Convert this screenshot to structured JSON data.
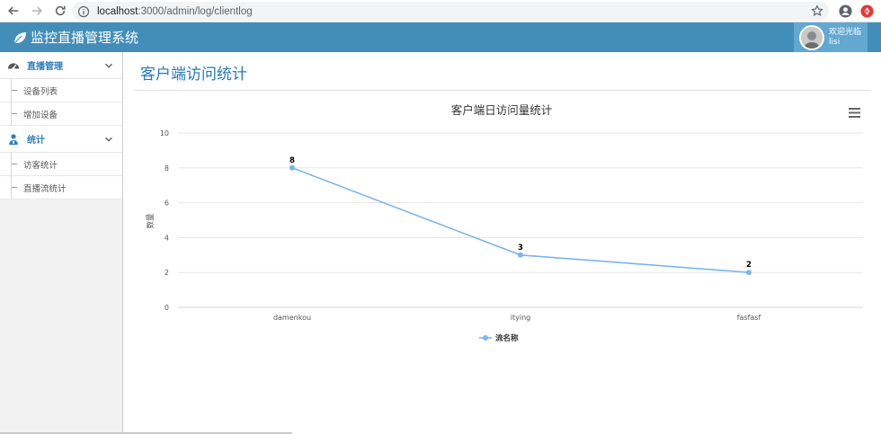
{
  "browser": {
    "url_host": "localhost",
    "url_path": ":3000/admin/log/clientlog"
  },
  "app": {
    "title": "监控直播管理系统",
    "user_greeting": "欢迎光临",
    "user_name": "lisi",
    "accent": "#438eb9"
  },
  "sidebar": {
    "groups": [
      {
        "label": "直播管理",
        "icon": "dashboard-icon",
        "items": [
          {
            "label": "设备列表"
          },
          {
            "label": "增加设备"
          }
        ]
      },
      {
        "label": "统计",
        "icon": "user-stats-icon",
        "items": [
          {
            "label": "访客统计"
          },
          {
            "label": "直播流统计"
          }
        ]
      }
    ]
  },
  "main": {
    "page_title": "客户端访问统计"
  },
  "chart_data": {
    "type": "line",
    "title": "客户端日访问量统计",
    "xlabel": "",
    "ylabel": "数量",
    "categories": [
      "damenkou",
      "itying",
      "fasfasf"
    ],
    "series": [
      {
        "name": "流名称",
        "values": [
          8,
          3,
          2
        ],
        "color": "#7cb5ec"
      }
    ],
    "ylim": [
      0,
      10
    ],
    "yticks": [
      0,
      2,
      4,
      6,
      8,
      10
    ],
    "grid": true,
    "legend": "bottom-center",
    "data_labels": true
  }
}
